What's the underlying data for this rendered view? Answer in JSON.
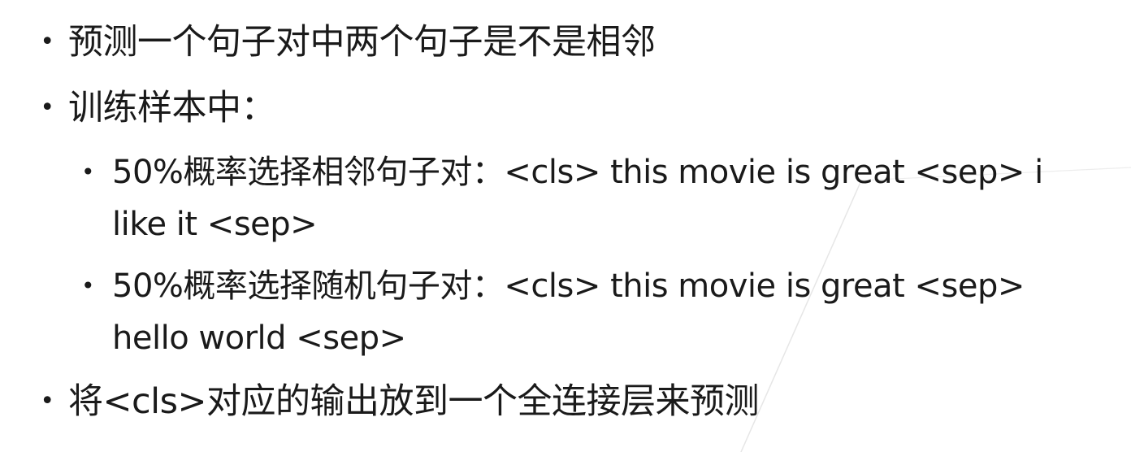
{
  "bullets": [
    {
      "text": "预测一个句子对中两个句子是不是相邻"
    },
    {
      "text": "训练样本中："
    },
    {
      "text": "50%概率选择相邻句子对：<cls> this movie is great <sep> i like it <sep>"
    },
    {
      "text": "50%概率选择随机句子对：<cls> this movie is great <sep> hello world <sep>"
    },
    {
      "text": "将<cls>对应的输出放到一个全连接层来预测"
    }
  ],
  "bullet_symbol": "•",
  "colors": {
    "text": "#1a1a1a",
    "decoration": "#e6e6e6"
  }
}
